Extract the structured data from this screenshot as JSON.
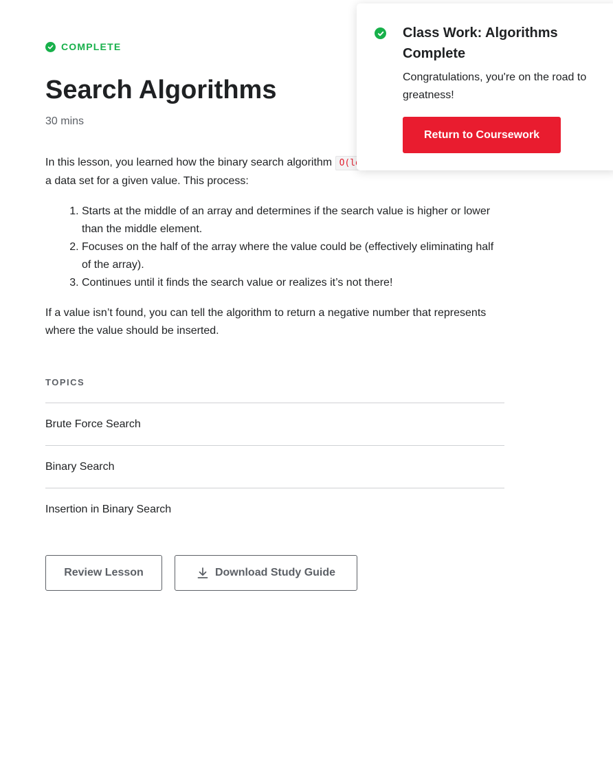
{
  "lesson": {
    "status": "COMPLETE",
    "title": "Search Algorithms",
    "duration": "30 mins",
    "intro_before": "In this lesson, you learned how the binary search algorithm",
    "intro_code": "O(log(N))",
    "intro_after": "complexity!) searches a data set for a given value. This process:",
    "steps": [
      "Starts at the middle of an array and determines if the search value is higher or lower than the middle element.",
      "Focuses on the half of the array where the value could be (effectively eliminating half of the array).",
      "Continues until it finds the search value or realizes it’s not there!"
    ],
    "outro": "If a value isn’t found, you can tell the algorithm to return a negative number that represents where the value should be inserted."
  },
  "topics": {
    "heading": "TOPICS",
    "items": [
      "Brute Force Search",
      "Binary Search",
      "Insertion in Binary Search"
    ]
  },
  "actions": {
    "review_label": "Review Lesson",
    "download_label": "Download Study Guide"
  },
  "toast": {
    "title": "Class Work: Algorithms Complete",
    "message": "Congratulations, you're on the road to greatness!",
    "button_label": "Return to Coursework"
  },
  "icons": {
    "status": "check-circle-icon",
    "toast": "check-circle-icon",
    "download": "download-icon"
  },
  "colors": {
    "success": "#17b04a",
    "accent": "#e91c2f",
    "code_text": "#e01f2f",
    "muted": "#5c6066"
  }
}
